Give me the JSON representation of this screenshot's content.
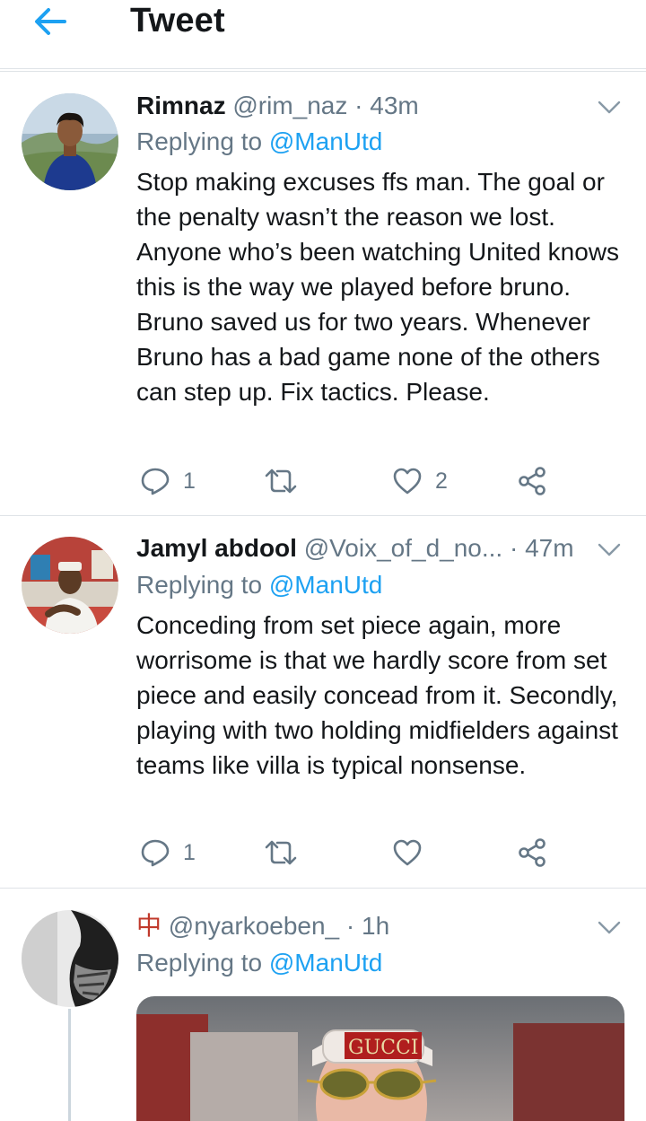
{
  "header": {
    "title": "Tweet",
    "back_icon": "arrow-left-icon",
    "accent": "#1da1f2"
  },
  "tweets": [
    {
      "name": "Rimnaz",
      "handle": "@rim_naz",
      "time": "· 43m",
      "replying_label": "Replying to",
      "replying_to": "@ManUtd",
      "text": "Stop making excuses ffs man. The goal or the penalty wasn’t the reason we lost. Anyone who’s been watching United knows this is the way we played before bruno. Bruno saved us for two years. Whenever Bruno has a bad game none of the others can step up. Fix tactics. Please.",
      "reply_count": "1",
      "retweet_count": "",
      "like_count": "2"
    },
    {
      "name": "Jamyl abdool",
      "handle": "@Voix_of_d_no...",
      "time": "· 47m",
      "replying_label": "Replying to",
      "replying_to": "@ManUtd",
      "text": "Conceding from set piece again, more worrisome is that we hardly score from set piece and easily concead from it. Secondly, playing with two holding midfielders against teams like villa is typical nonsense.",
      "reply_count": "1",
      "retweet_count": "",
      "like_count": ""
    },
    {
      "name": "中",
      "handle": "@nyarkoeben_",
      "time": "· 1h",
      "replying_label": "Replying to",
      "replying_to": "@ManUtd",
      "media_text": "GUCCI"
    }
  ]
}
